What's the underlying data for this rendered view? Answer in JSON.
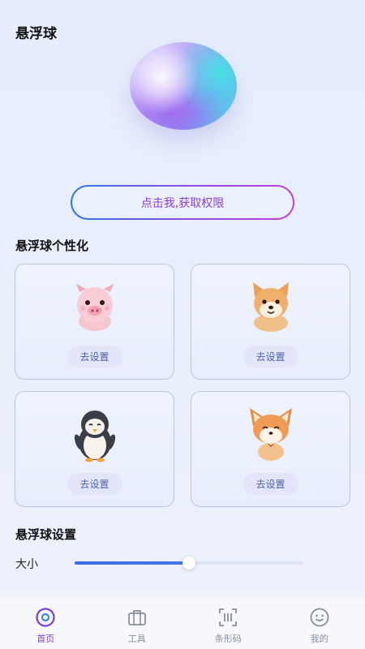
{
  "page": {
    "title": "悬浮球"
  },
  "permission_button": {
    "label": "点击我,获取权限"
  },
  "personalize": {
    "title": "悬浮球个性化",
    "cards": [
      {
        "pet": "pig",
        "button": "去设置"
      },
      {
        "pet": "shiba-dog",
        "button": "去设置"
      },
      {
        "pet": "penguin",
        "button": "去设置"
      },
      {
        "pet": "fox",
        "button": "去设置"
      }
    ]
  },
  "settings": {
    "title": "悬浮球设置",
    "size_label": "大小",
    "size_value": 0.5
  },
  "tabbar": {
    "active": 0,
    "active_color": "#7b3fd9",
    "inactive_color": "#8a8e99",
    "items": [
      {
        "label": "首页",
        "icon": "home-eye-icon"
      },
      {
        "label": "工具",
        "icon": "toolbox-icon"
      },
      {
        "label": "条形码",
        "icon": "barcode-scan-icon"
      },
      {
        "label": "我的",
        "icon": "smiley-face-icon"
      }
    ]
  }
}
